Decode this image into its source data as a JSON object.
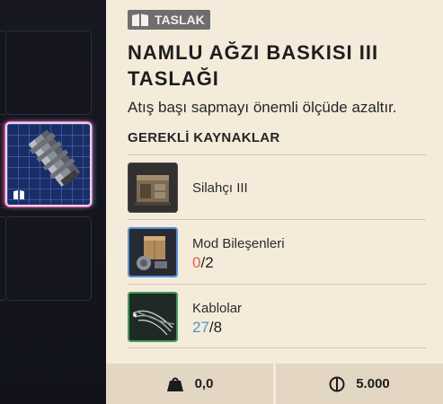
{
  "inventory": {
    "selected_slot_icon": "blueprint-icon",
    "item_art": "muzzle-brake-blueprint-art"
  },
  "panel": {
    "tag": {
      "icon": "blueprint-icon",
      "label": "TASLAK"
    },
    "title": "NAMLU AĞZI BASKISI III TASLAĞI",
    "description": "Atış başı sapmayı önemli ölçüde azaltır.",
    "requirements_header": "GEREKLİ KAYNAKLAR",
    "requirements": [
      {
        "name": "Silahçı III",
        "icon": "gunsmith-bench-icon",
        "have": "",
        "sep": "",
        "need": ""
      },
      {
        "name": "Mod Bileşenleri",
        "icon": "mod-components-icon",
        "have": "0",
        "sep": "/",
        "need": "2"
      },
      {
        "name": "Kablolar",
        "icon": "cables-icon",
        "have": "27",
        "sep": "/",
        "need": "8"
      }
    ]
  },
  "footer": {
    "weight": "0,0",
    "weight_icon": "weight-icon",
    "price": "5.000",
    "price_icon": "coin-icon"
  },
  "colors": {
    "panel_bg": "#f5ebdb",
    "footer_bg": "#e3d7c4",
    "tag_bg": "#6e6e70",
    "insufficient": "#e0604b",
    "sufficient": "#4e9bb8",
    "selected_glow": "#ff5ab4"
  }
}
